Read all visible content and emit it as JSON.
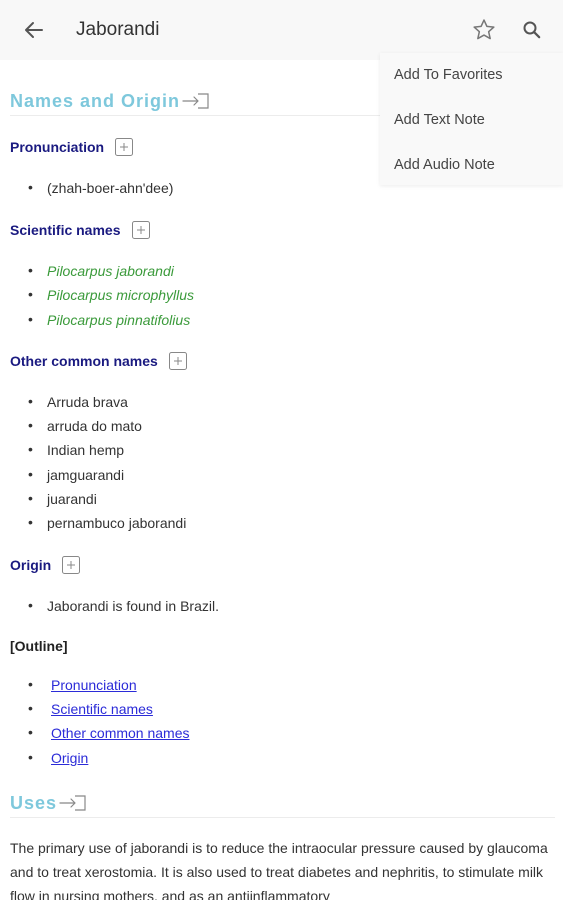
{
  "appbar": {
    "title": "Jaborandi"
  },
  "menu": {
    "items": [
      {
        "label": "Add To Favorites"
      },
      {
        "label": "Add Text Note"
      },
      {
        "label": "Add Audio Note"
      }
    ]
  },
  "names_origin": {
    "heading": "Names and Origin",
    "pronunciation": {
      "label": "Pronunciation",
      "items": [
        "(zhah-boer-ahn'dee)"
      ]
    },
    "scientific": {
      "label": "Scientific names",
      "items": [
        "Pilocarpus jaborandi",
        "Pilocarpus microphyllus",
        "Pilocarpus pinnatifolius"
      ]
    },
    "common": {
      "label": "Other common names",
      "items": [
        "Arruda brava",
        "arruda do mato",
        "Indian hemp",
        "jamguarandi",
        "juarandi",
        "pernambuco jaborandi"
      ]
    },
    "origin": {
      "label": "Origin",
      "items": [
        "Jaborandi is found in Brazil."
      ]
    },
    "outline": {
      "label": "[Outline]",
      "links": [
        "Pronunciation",
        "Scientific names",
        "Other common names",
        "Origin"
      ]
    }
  },
  "uses": {
    "heading": "Uses",
    "paragraph": "The primary use of jaborandi is to reduce the intraocular pressure caused by glaucoma and to treat xerostomia. It is also used to treat diabetes and nephritis, to stimulate milk flow in nursing mothers, and as an antiinflammatory"
  },
  "colors": {
    "heading": "#7ec8dc",
    "subheading": "#1a1a80",
    "scientific": "#3a9a3a",
    "link": "#2b2bd8"
  }
}
